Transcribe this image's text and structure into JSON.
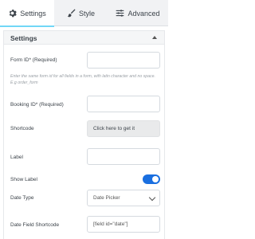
{
  "tabs": [
    {
      "label": "Settings",
      "icon": "gear-icon",
      "active": true
    },
    {
      "label": "Style",
      "icon": "brush-icon",
      "active": false
    },
    {
      "label": "Advanced",
      "icon": "sliders-icon",
      "active": false
    }
  ],
  "panel": {
    "title": "Settings",
    "fields": {
      "form_id": {
        "label": "Form ID* (Required)",
        "value": ""
      },
      "form_id_help": "Enter the same form id for all fields in a form, with latin character and no space. E.g order_form",
      "booking_id": {
        "label": "Booking ID* (Required)",
        "value": ""
      },
      "shortcode": {
        "label": "Shortcode",
        "button": "Click here to get it"
      },
      "label": {
        "label": "Label",
        "value": ""
      },
      "show_label": {
        "label": "Show Label",
        "on": true
      },
      "date_type": {
        "label": "Date Type",
        "selected": "Date Picker"
      },
      "date_field_shortcode": {
        "label": "Date Field Shortcode",
        "value": "[field id=\"date\"]"
      }
    }
  },
  "colors": {
    "accent": "#71d7f7",
    "toggle_on": "#1a6fe0"
  }
}
